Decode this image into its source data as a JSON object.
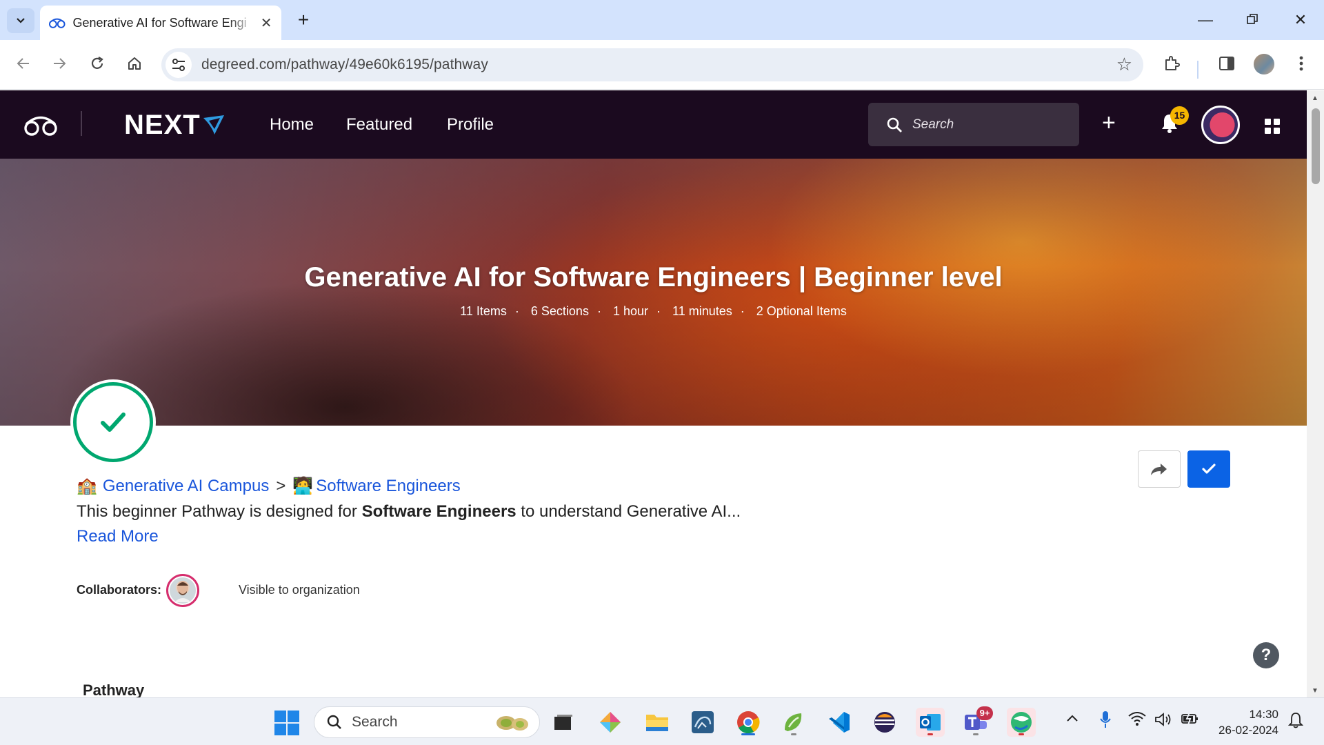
{
  "browser": {
    "tab_title": "Generative AI for Software Engineers | Beginner level",
    "tab_title_visible": "Generative AI for Software Engi",
    "url": "degreed.com/pathway/49e60k6195/pathway"
  },
  "appnav": {
    "brand": "NEXT",
    "links": [
      "Home",
      "Featured",
      "Profile"
    ],
    "search_placeholder": "Search",
    "notification_count": "15"
  },
  "hero": {
    "title": "Generative AI for Software Engineers | Beginner level",
    "meta": [
      "11 Items",
      "6 Sections",
      "1 hour",
      "11 minutes",
      "2 Optional Items"
    ]
  },
  "content": {
    "breadcrumb": [
      {
        "emoji": "🏫",
        "label": "Generative AI Campus"
      },
      {
        "emoji": "🧑‍💻",
        "label": "Software Engineers"
      }
    ],
    "breadcrumb_sep": ">",
    "description_pre": "This beginner Pathway is designed for ",
    "description_bold": "Software Engineers",
    "description_post": " to understand Generative AI...",
    "read_more": "Read More",
    "collaborators_label": "Collaborators:",
    "visibility": "Visible to organization",
    "section_heading": "Pathway"
  },
  "taskbar": {
    "search_placeholder": "Search",
    "teams_badge": "9+",
    "time": "14:30",
    "date": "26-02-2024"
  },
  "colors": {
    "nav_bg": "#1b0a1f",
    "accent_blue": "#0b63e5",
    "link_blue": "#1a56db",
    "complete_green": "#00a76f",
    "badge_yellow": "#f5b600"
  }
}
